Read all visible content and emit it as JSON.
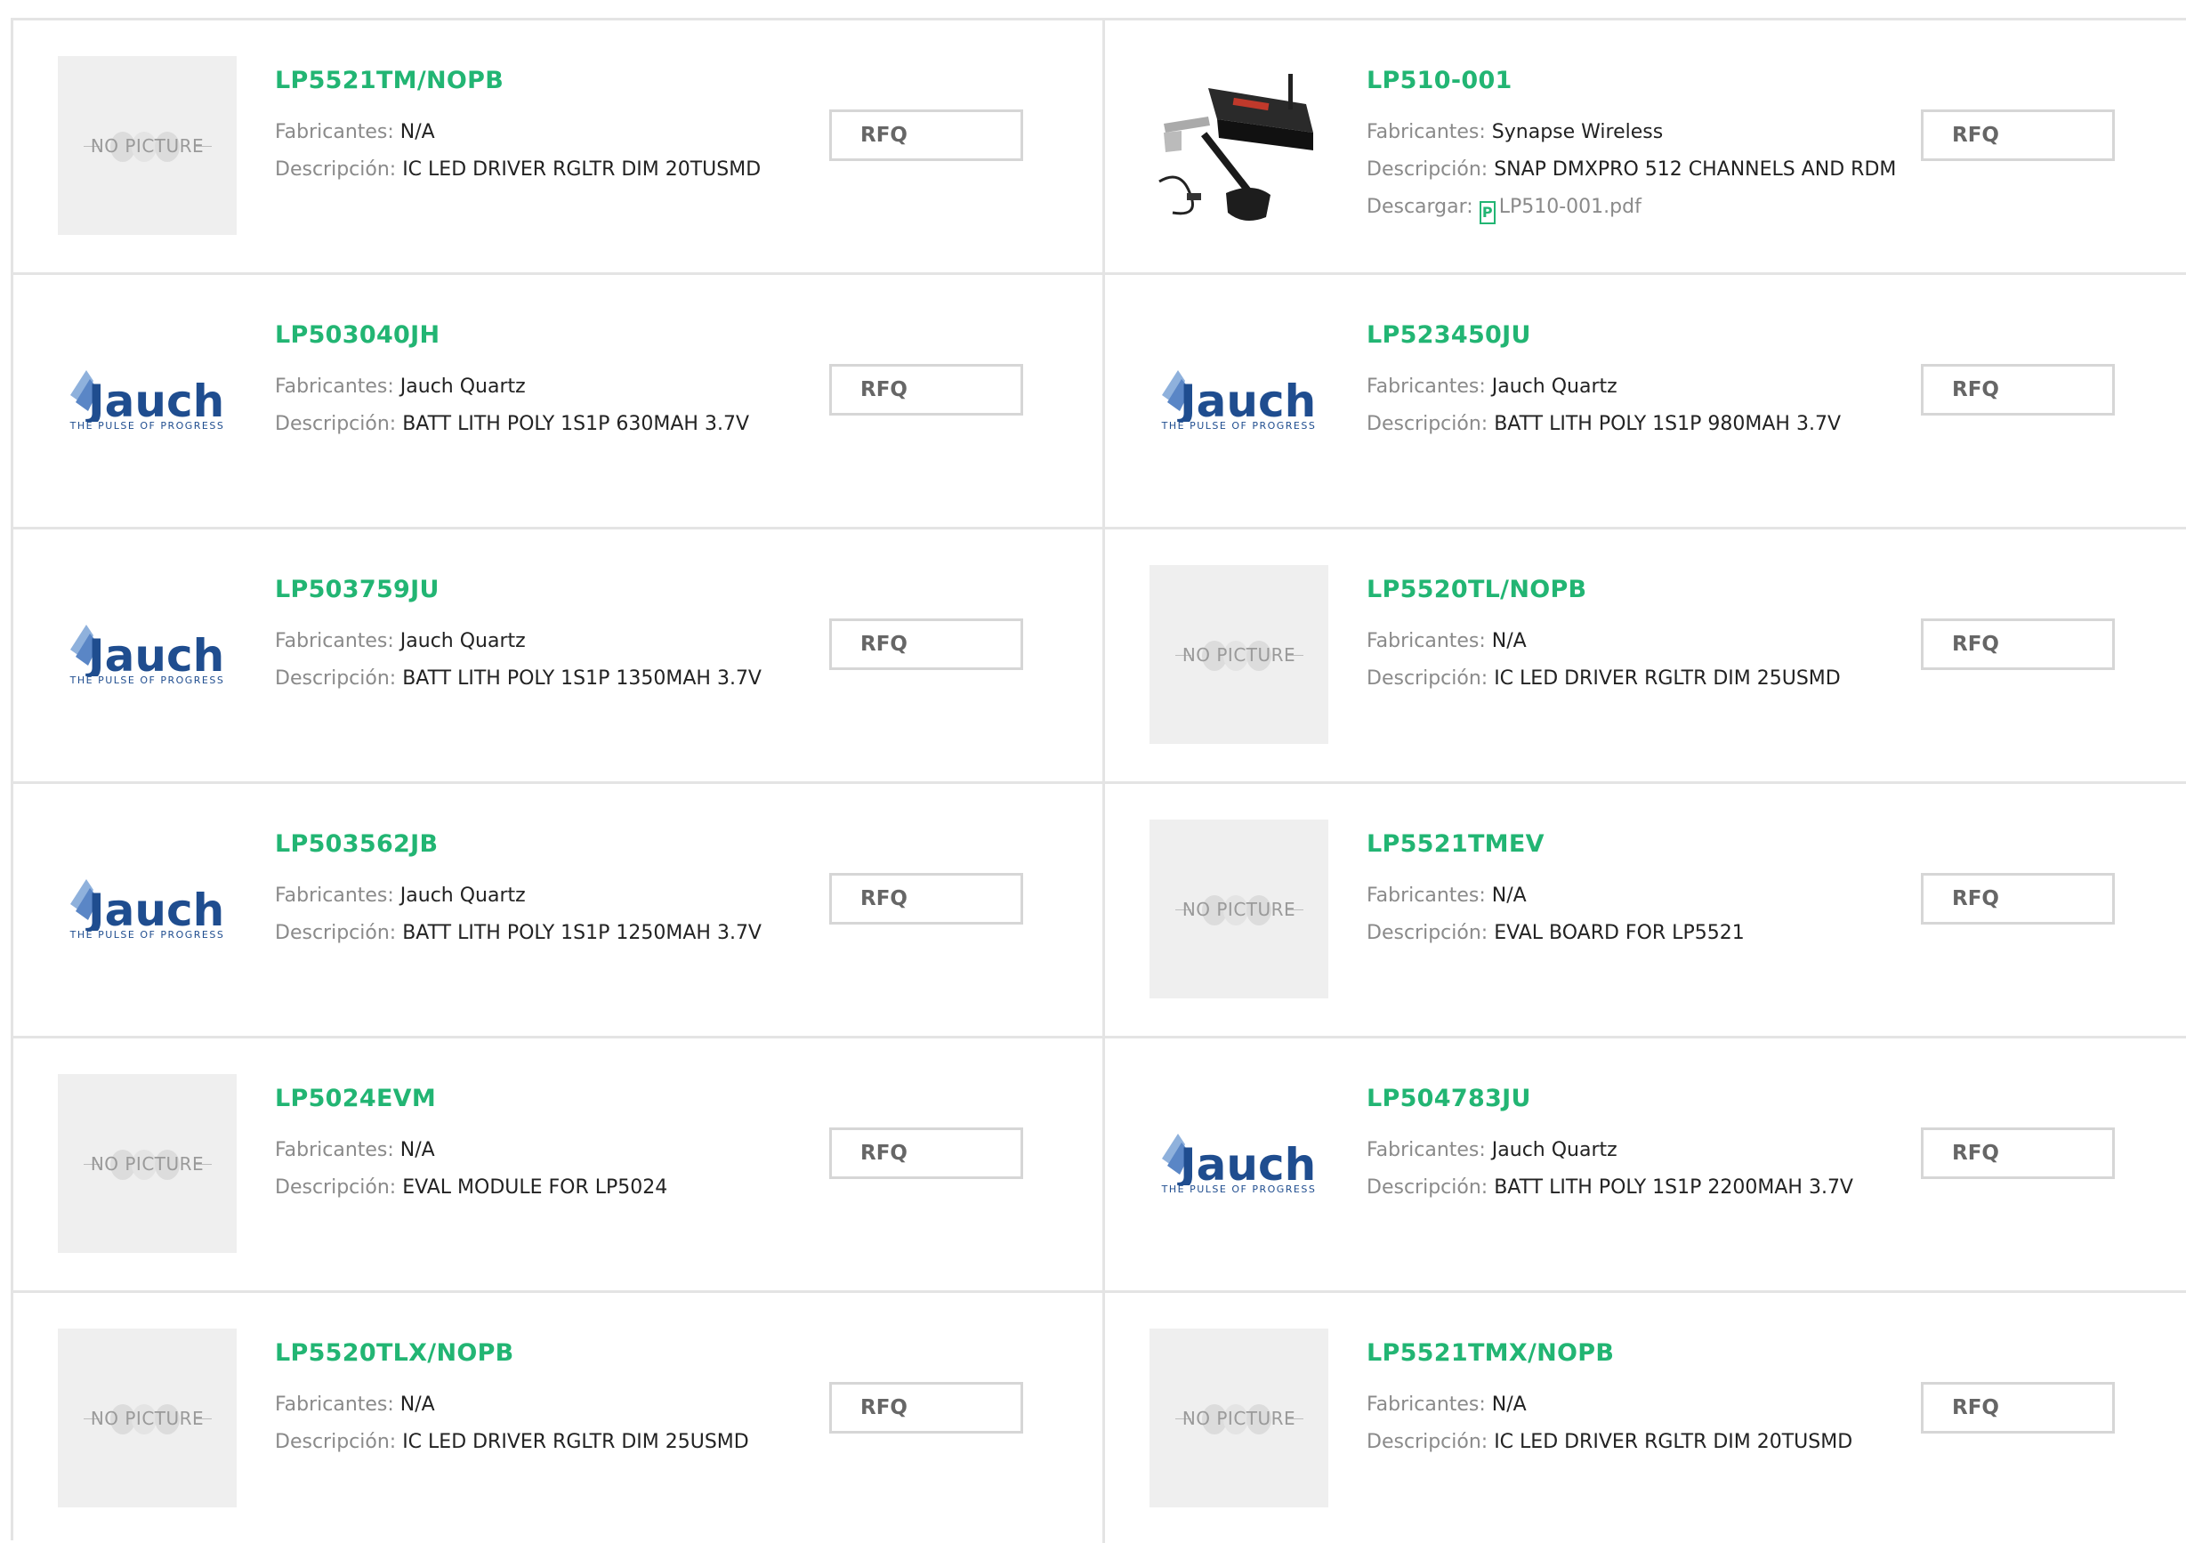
{
  "labels": {
    "manufacturer": "Fabricantes:",
    "description": "Descripción:",
    "download": "Descargar:",
    "rfq": "RFQ",
    "no_picture": "NO PICTURE",
    "logo_tagline": "THE PULSE OF PROGRESS",
    "logo_word": "Jauch",
    "pdf_icon": "P"
  },
  "products": [
    {
      "part": "LP5521TM/NOPB",
      "manufacturer": "N/A",
      "description": "IC LED DRIVER RGLTR DIM 20TUSMD",
      "image": "no-picture"
    },
    {
      "part": "LP510-001",
      "manufacturer": "Synapse Wireless",
      "description": "SNAP DMXPRO 512 CHANNELS AND RDM",
      "download": "LP510-001.pdf",
      "image": "product-photo"
    },
    {
      "part": "LP503040JH",
      "manufacturer": "Jauch Quartz",
      "description": "BATT LITH POLY 1S1P 630MAH 3.7V",
      "image": "jauch-logo"
    },
    {
      "part": "LP523450JU",
      "manufacturer": "Jauch Quartz",
      "description": "BATT LITH POLY 1S1P 980MAH 3.7V",
      "image": "jauch-logo"
    },
    {
      "part": "LP503759JU",
      "manufacturer": "Jauch Quartz",
      "description": "BATT LITH POLY 1S1P 1350MAH 3.7V",
      "image": "jauch-logo"
    },
    {
      "part": "LP5520TL/NOPB",
      "manufacturer": "N/A",
      "description": "IC LED DRIVER RGLTR DIM 25USMD",
      "image": "no-picture"
    },
    {
      "part": "LP503562JB",
      "manufacturer": "Jauch Quartz",
      "description": "BATT LITH POLY 1S1P 1250MAH 3.7V",
      "image": "jauch-logo"
    },
    {
      "part": "LP5521TMEV",
      "manufacturer": "N/A",
      "description": "EVAL BOARD FOR LP5521",
      "image": "no-picture"
    },
    {
      "part": "LP5024EVM",
      "manufacturer": "N/A",
      "description": "EVAL MODULE FOR LP5024",
      "image": "no-picture"
    },
    {
      "part": "LP504783JU",
      "manufacturer": "Jauch Quartz",
      "description": "BATT LITH POLY 1S1P 2200MAH 3.7V",
      "image": "jauch-logo"
    },
    {
      "part": "LP5520TLX/NOPB",
      "manufacturer": "N/A",
      "description": "IC LED DRIVER RGLTR DIM 25USMD",
      "image": "no-picture"
    },
    {
      "part": "LP5521TMX/NOPB",
      "manufacturer": "N/A",
      "description": "IC LED DRIVER RGLTR DIM 20TUSMD",
      "image": "no-picture"
    }
  ],
  "colors": {
    "accent": "#22b573",
    "label_gray": "#8a8a8a",
    "border": "#e4e4e4"
  }
}
